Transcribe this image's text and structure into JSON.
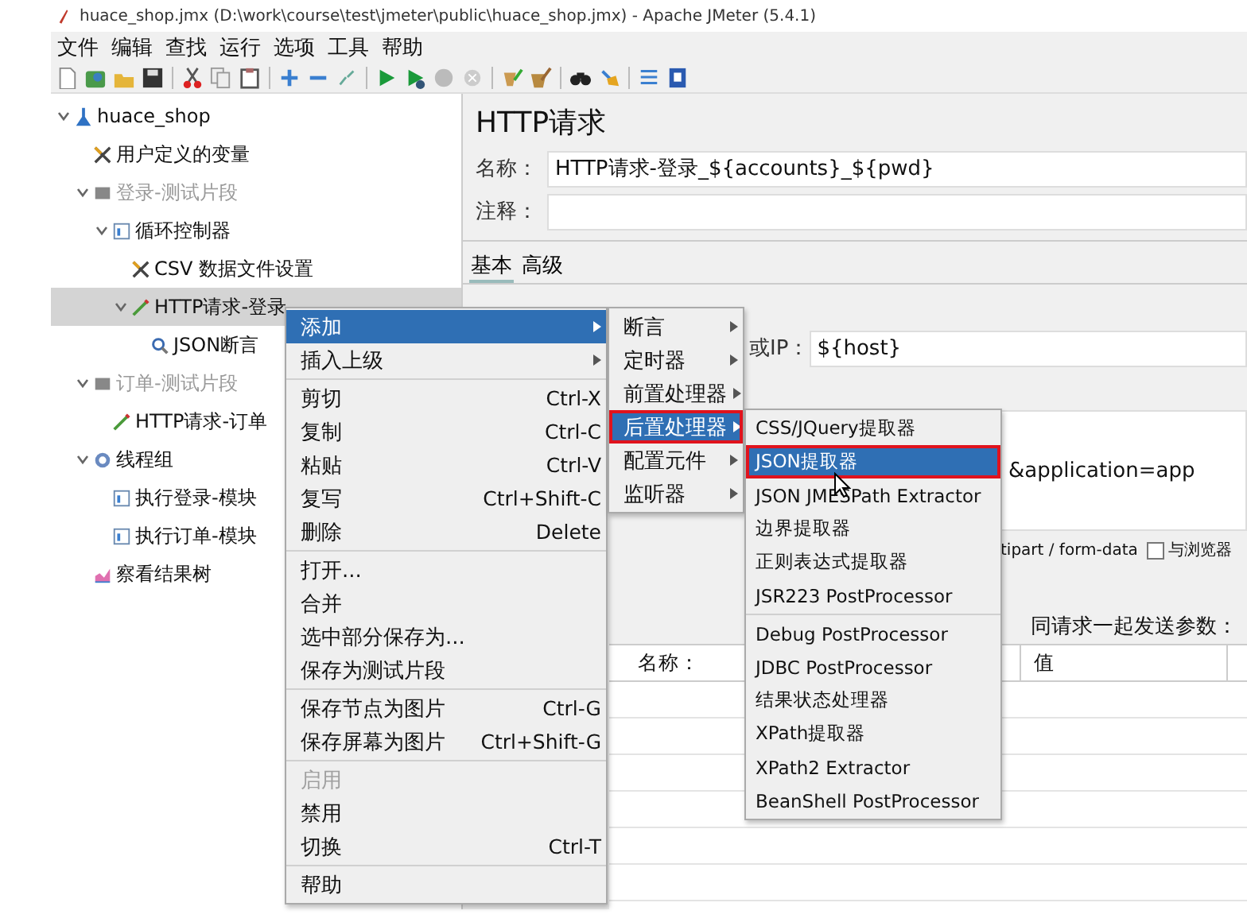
{
  "window": {
    "title": "huace_shop.jmx (D:\\work\\course\\test\\jmeter\\public\\huace_shop.jmx) - Apache JMeter (5.4.1)"
  },
  "menu_bar": [
    "文件",
    "编辑",
    "查找",
    "运行",
    "选项",
    "工具",
    "帮助"
  ],
  "tree": [
    {
      "label": "huace_shop",
      "kind": "plan",
      "expanded": true,
      "selected": false,
      "disabled": false,
      "children": [
        {
          "label": "用户定义的变量",
          "kind": "config",
          "selected": false,
          "disabled": false
        },
        {
          "label": "登录-测试片段",
          "kind": "fragment",
          "expanded": true,
          "selected": false,
          "disabled": true,
          "children": [
            {
              "label": "循环控制器",
              "kind": "controller",
              "expanded": true,
              "selected": false,
              "disabled": false,
              "children": [
                {
                  "label": "CSV 数据文件设置",
                  "kind": "config",
                  "selected": false,
                  "disabled": false
                },
                {
                  "label": "HTTP请求-登录",
                  "kind": "sampler",
                  "expanded": true,
                  "selected": true,
                  "disabled": false,
                  "children": [
                    {
                      "label": "JSON断言",
                      "kind": "assertion",
                      "selected": false,
                      "disabled": false
                    }
                  ]
                }
              ]
            }
          ]
        },
        {
          "label": "订单-测试片段",
          "kind": "fragment",
          "expanded": true,
          "selected": false,
          "disabled": true,
          "children": [
            {
              "label": "HTTP请求-订单",
              "kind": "sampler",
              "selected": false,
              "disabled": false
            }
          ]
        },
        {
          "label": "线程组",
          "kind": "thread-group",
          "expanded": true,
          "selected": false,
          "disabled": false,
          "children": [
            {
              "label": "执行登录-模块",
              "kind": "module",
              "selected": false,
              "disabled": false
            },
            {
              "label": "执行订单-模块",
              "kind": "module",
              "selected": false,
              "disabled": false
            }
          ]
        },
        {
          "label": "察看结果树",
          "kind": "listener",
          "selected": false,
          "disabled": false
        }
      ]
    }
  ],
  "editor": {
    "heading": "HTTP请求",
    "name_label": "名称：",
    "name_value": "HTTP请求-登录_${accounts}_${pwd}",
    "comment_label": "注释：",
    "tabs": [
      {
        "label": "基本",
        "selected": true
      },
      {
        "label": "高级",
        "selected": false
      }
    ],
    "server_label": "或IP：",
    "server_value": "${host}",
    "path_value": "&application=app",
    "encoding_text": "tipart / form-data",
    "browser_compat": {
      "label": "与浏览器",
      "checked": false
    },
    "params_label": "同请求一起发送参数：",
    "columns": [
      "名称：",
      "值"
    ]
  },
  "context_menu": {
    "groups": [
      [
        {
          "label": "添加",
          "submenu": true,
          "selected": true,
          "disabled": false
        },
        {
          "label": "插入上级",
          "submenu": true,
          "selected": false,
          "disabled": false
        }
      ],
      [
        {
          "label": "剪切",
          "shortcut": "Ctrl-X",
          "selected": false,
          "disabled": false
        },
        {
          "label": "复制",
          "shortcut": "Ctrl-C",
          "selected": false,
          "disabled": false
        },
        {
          "label": "粘贴",
          "shortcut": "Ctrl-V",
          "selected": false,
          "disabled": false
        },
        {
          "label": "复写",
          "shortcut": "Ctrl+Shift-C",
          "selected": false,
          "disabled": false
        },
        {
          "label": "删除",
          "shortcut": "Delete",
          "selected": false,
          "disabled": false
        }
      ],
      [
        {
          "label": "打开...",
          "selected": false,
          "disabled": false
        },
        {
          "label": "合并",
          "selected": false,
          "disabled": false
        },
        {
          "label": "选中部分保存为...",
          "selected": false,
          "disabled": false
        },
        {
          "label": "保存为测试片段",
          "selected": false,
          "disabled": false
        }
      ],
      [
        {
          "label": "保存节点为图片",
          "shortcut": "Ctrl-G",
          "selected": false,
          "disabled": false
        },
        {
          "label": "保存屏幕为图片",
          "shortcut": "Ctrl+Shift-G",
          "selected": false,
          "disabled": false
        }
      ],
      [
        {
          "label": "启用",
          "selected": false,
          "disabled": true
        },
        {
          "label": "禁用",
          "selected": false,
          "disabled": false
        },
        {
          "label": "切换",
          "shortcut": "Ctrl-T",
          "selected": false,
          "disabled": false
        }
      ],
      [
        {
          "label": "帮助",
          "selected": false,
          "disabled": false
        }
      ]
    ]
  },
  "add_submenu": {
    "groups": [
      [
        {
          "label": "断言",
          "submenu": true,
          "selected": false,
          "highlighted": false
        },
        {
          "label": "定时器",
          "submenu": true,
          "selected": false,
          "highlighted": false
        },
        {
          "label": "前置处理器",
          "submenu": true,
          "selected": false,
          "highlighted": false
        },
        {
          "label": "后置处理器",
          "submenu": true,
          "selected": true,
          "highlighted": true
        },
        {
          "label": "配置元件",
          "submenu": true,
          "selected": false,
          "highlighted": false
        },
        {
          "label": "监听器",
          "submenu": true,
          "selected": false,
          "highlighted": false
        }
      ]
    ]
  },
  "postprocessor_submenu": {
    "groups": [
      [
        {
          "label": "CSS/JQuery提取器",
          "selected": false,
          "highlighted": false
        },
        {
          "label": "JSON提取器",
          "selected": true,
          "highlighted": true
        },
        {
          "label": "JSON JMESPath Extractor",
          "selected": false,
          "highlighted": false
        },
        {
          "label": "边界提取器",
          "selected": false,
          "highlighted": false
        },
        {
          "label": "正则表达式提取器",
          "selected": false,
          "highlighted": false
        },
        {
          "label": "JSR223 PostProcessor",
          "selected": false,
          "highlighted": false
        }
      ],
      [
        {
          "label": "Debug PostProcessor",
          "selected": false,
          "highlighted": false
        },
        {
          "label": "JDBC PostProcessor",
          "selected": false,
          "highlighted": false
        },
        {
          "label": "结果状态处理器",
          "selected": false,
          "highlighted": false
        },
        {
          "label": "XPath提取器",
          "selected": false,
          "highlighted": false
        },
        {
          "label": "XPath2 Extractor",
          "selected": false,
          "highlighted": false
        },
        {
          "label": "BeanShell PostProcessor",
          "selected": false,
          "highlighted": false
        }
      ]
    ]
  }
}
